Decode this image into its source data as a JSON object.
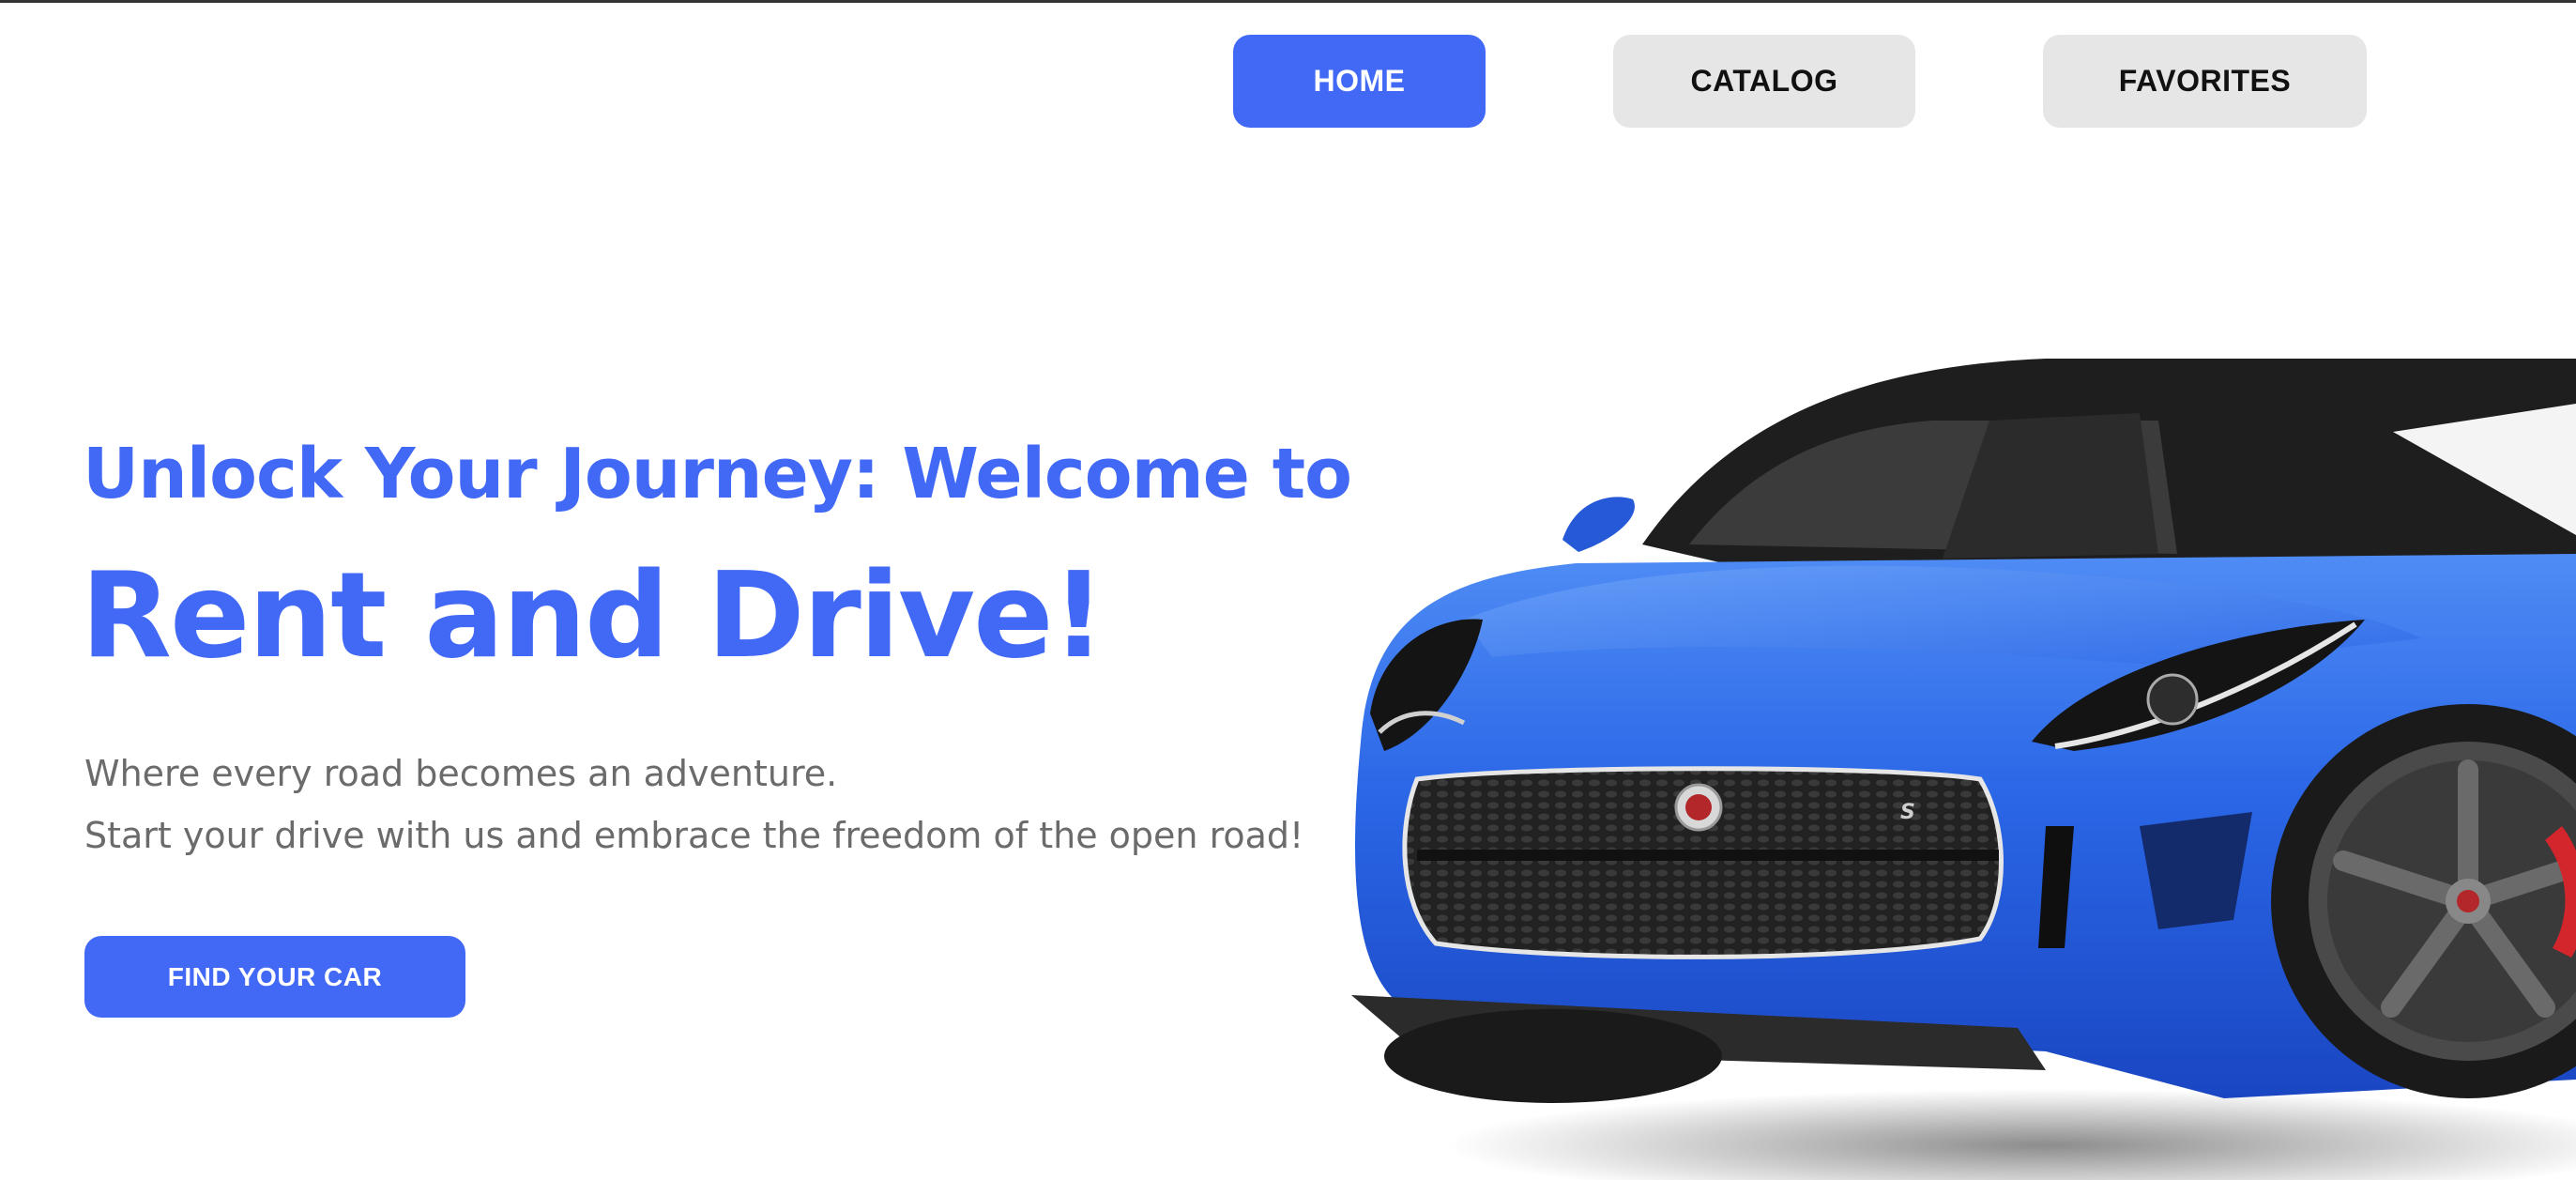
{
  "nav": {
    "home_label": "HOME",
    "catalog_label": "CATALOG",
    "favorites_label": "FAVORITES"
  },
  "hero": {
    "subtitle": "Unlock Your Journey: Welcome to",
    "title": "Rent and Drive!",
    "description_line1": "Where every road becomes an adventure.",
    "description_line2": "Start your drive with us and embrace the freedom of the open road!",
    "cta_label": "FIND YOUR CAR"
  },
  "colors": {
    "accent": "#4169f5",
    "nav_inactive_bg": "#e6e6e6",
    "text_muted": "#6b6b6b",
    "car_body": "#2a66e6"
  }
}
